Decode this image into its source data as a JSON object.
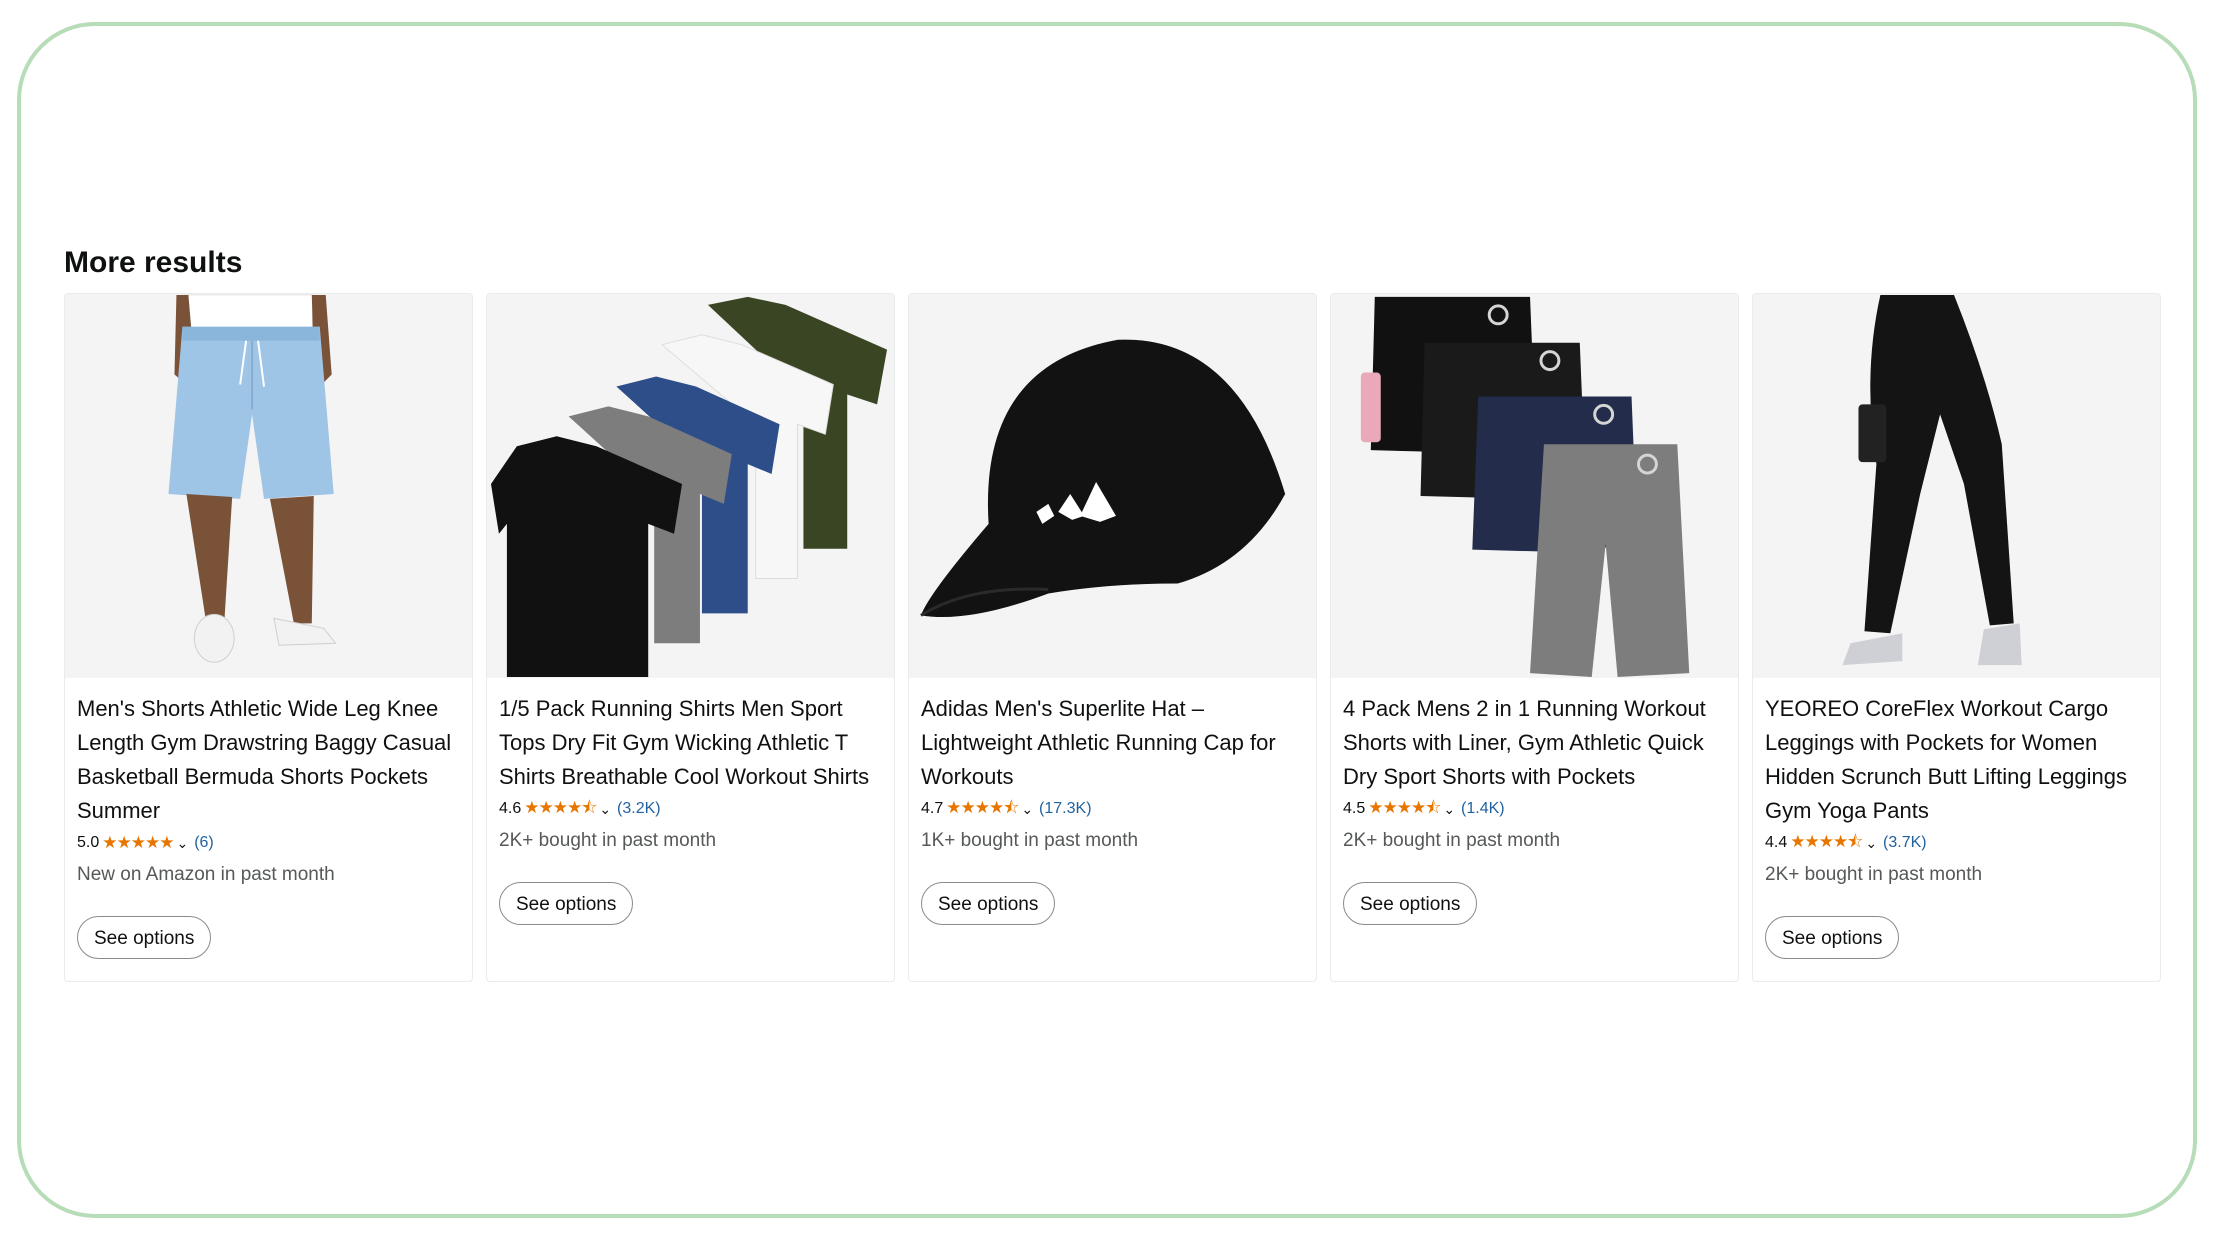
{
  "section_title": "More results",
  "products": [
    {
      "title": "Men's Shorts Athletic Wide Leg Knee Length Gym Drawstring Baggy Casual Basketball Bermuda Shorts Pockets Summer",
      "rating": "5.0",
      "stars": "★★★★★",
      "chevron": "⌄",
      "review_count": "(6)",
      "bought": "New on Amazon in past month",
      "button": "See options",
      "image_icon": "light-blue-shorts-image"
    },
    {
      "title": "1/5 Pack Running Shirts Men Sport Tops Dry Fit Gym Wicking Athletic T Shirts Breathable Cool Workout Shirts",
      "rating": "4.6",
      "stars": "★★★★⯪",
      "chevron": "⌄",
      "review_count": "(3.2K)",
      "bought": "2K+ bought in past month",
      "button": "See options",
      "image_icon": "five-tshirts-image"
    },
    {
      "title": "Adidas Men's Superlite Hat – Lightweight Athletic Running Cap for Workouts",
      "rating": "4.7",
      "stars": "★★★★⯪",
      "chevron": "⌄",
      "review_count": "(17.3K)",
      "bought": "1K+ bought in past month",
      "button": "See options",
      "image_icon": "black-cap-image"
    },
    {
      "title": "4 Pack Mens 2 in 1 Running Workout Shorts with Liner, Gym Athletic Quick Dry Sport Shorts with Pockets",
      "rating": "4.5",
      "stars": "★★★★⯪",
      "chevron": "⌄",
      "review_count": "(1.4K)",
      "bought": "2K+ bought in past month",
      "button": "See options",
      "image_icon": "four-shorts-image"
    },
    {
      "title": "YEOREO CoreFlex Workout Cargo Leggings with Pockets for Women Hidden Scrunch Butt Lifting Leggings Gym Yoga Pants",
      "rating": "4.4",
      "stars": "★★★★⯪",
      "chevron": "⌄",
      "review_count": "(3.7K)",
      "bought": "2K+ bought in past month",
      "button": "See options",
      "image_icon": "black-leggings-image"
    }
  ],
  "colors": {
    "frame": "#b7dcb8",
    "stars": "#e77600",
    "link": "#2162a1",
    "muted_text": "#565959"
  }
}
